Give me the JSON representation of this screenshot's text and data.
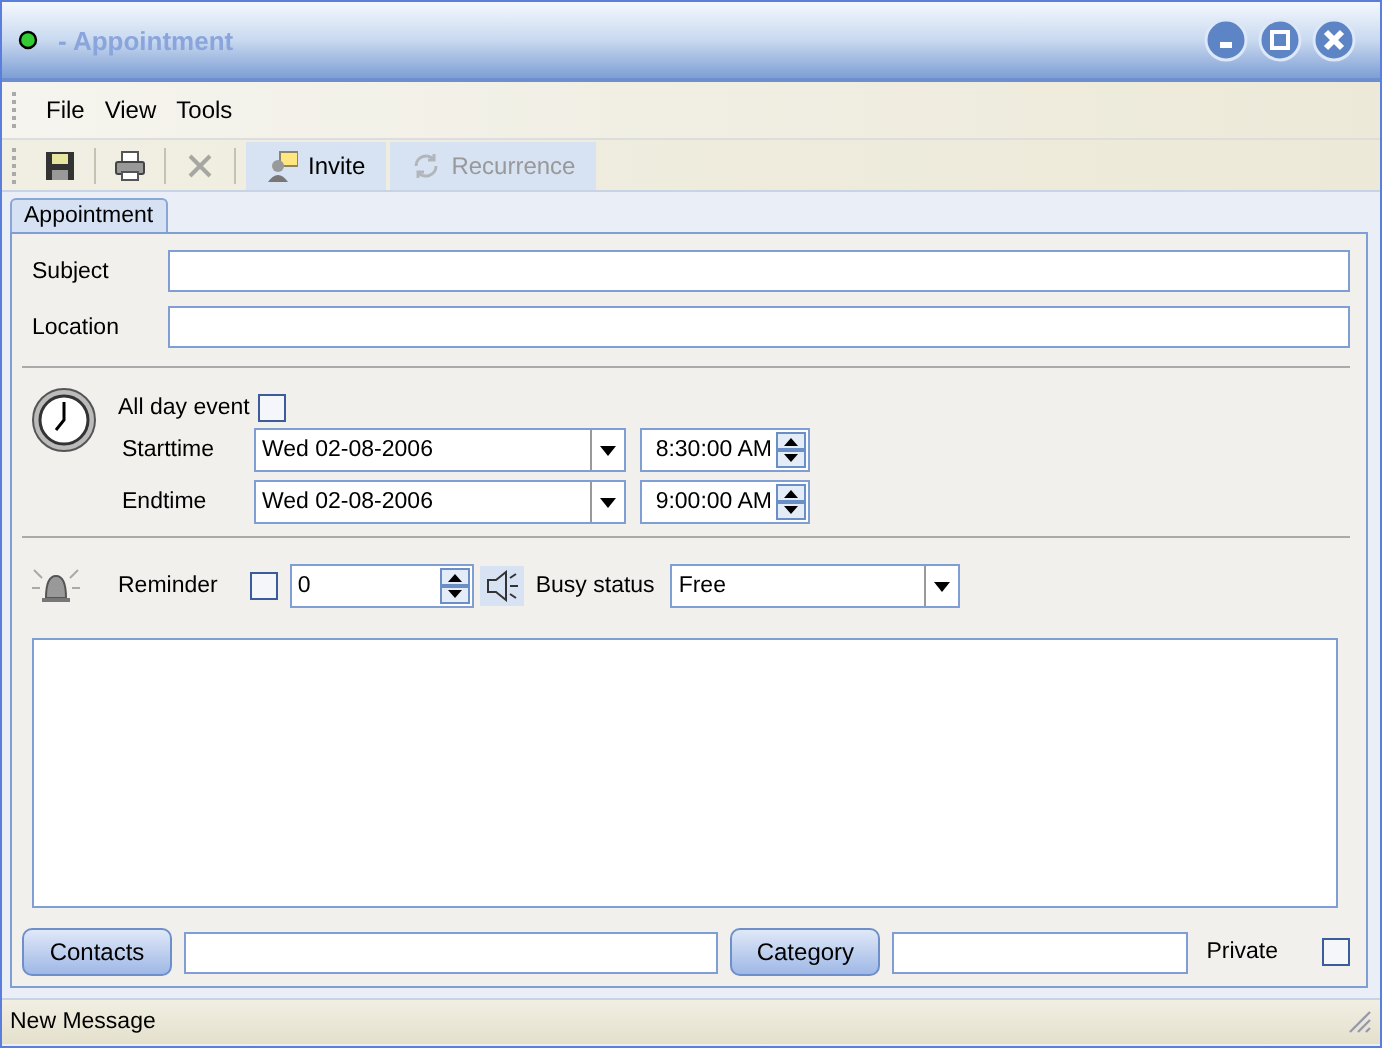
{
  "window": {
    "title": "- Appointment"
  },
  "menu": [
    {
      "label": "File"
    },
    {
      "label": "View"
    },
    {
      "label": "Tools"
    }
  ],
  "toolbar": [
    {
      "kind": "save",
      "disabled": false
    },
    {
      "kind": "print",
      "disabled": false
    },
    {
      "kind": "delete",
      "disabled": true
    },
    {
      "kind": "invite",
      "label": "Invite",
      "disabled": false
    },
    {
      "kind": "recurrence",
      "label": "Recurrence",
      "disabled": true
    }
  ],
  "tabs": [
    {
      "label": "Appointment",
      "selected": true
    }
  ],
  "fields": [
    {
      "label": "Subject"
    },
    {
      "label": "Location"
    }
  ],
  "all_day": {
    "label": "All day event",
    "checked": false
  },
  "times": [
    {
      "label": "Starttime",
      "date": "Wed 02-08-2006",
      "time": "8:30:00 AM"
    },
    {
      "label": "Endtime",
      "date": "Wed 02-08-2006",
      "time": "9:00:00 AM"
    }
  ],
  "reminder": {
    "label": "Reminder",
    "checked": false,
    "value": "0"
  },
  "busy": {
    "label": "Busy status",
    "value": "Free"
  },
  "bottom": {
    "contacts": "Contacts",
    "category": "Category",
    "private": {
      "label": "Private",
      "checked": false
    }
  },
  "status_bar": "New Message"
}
